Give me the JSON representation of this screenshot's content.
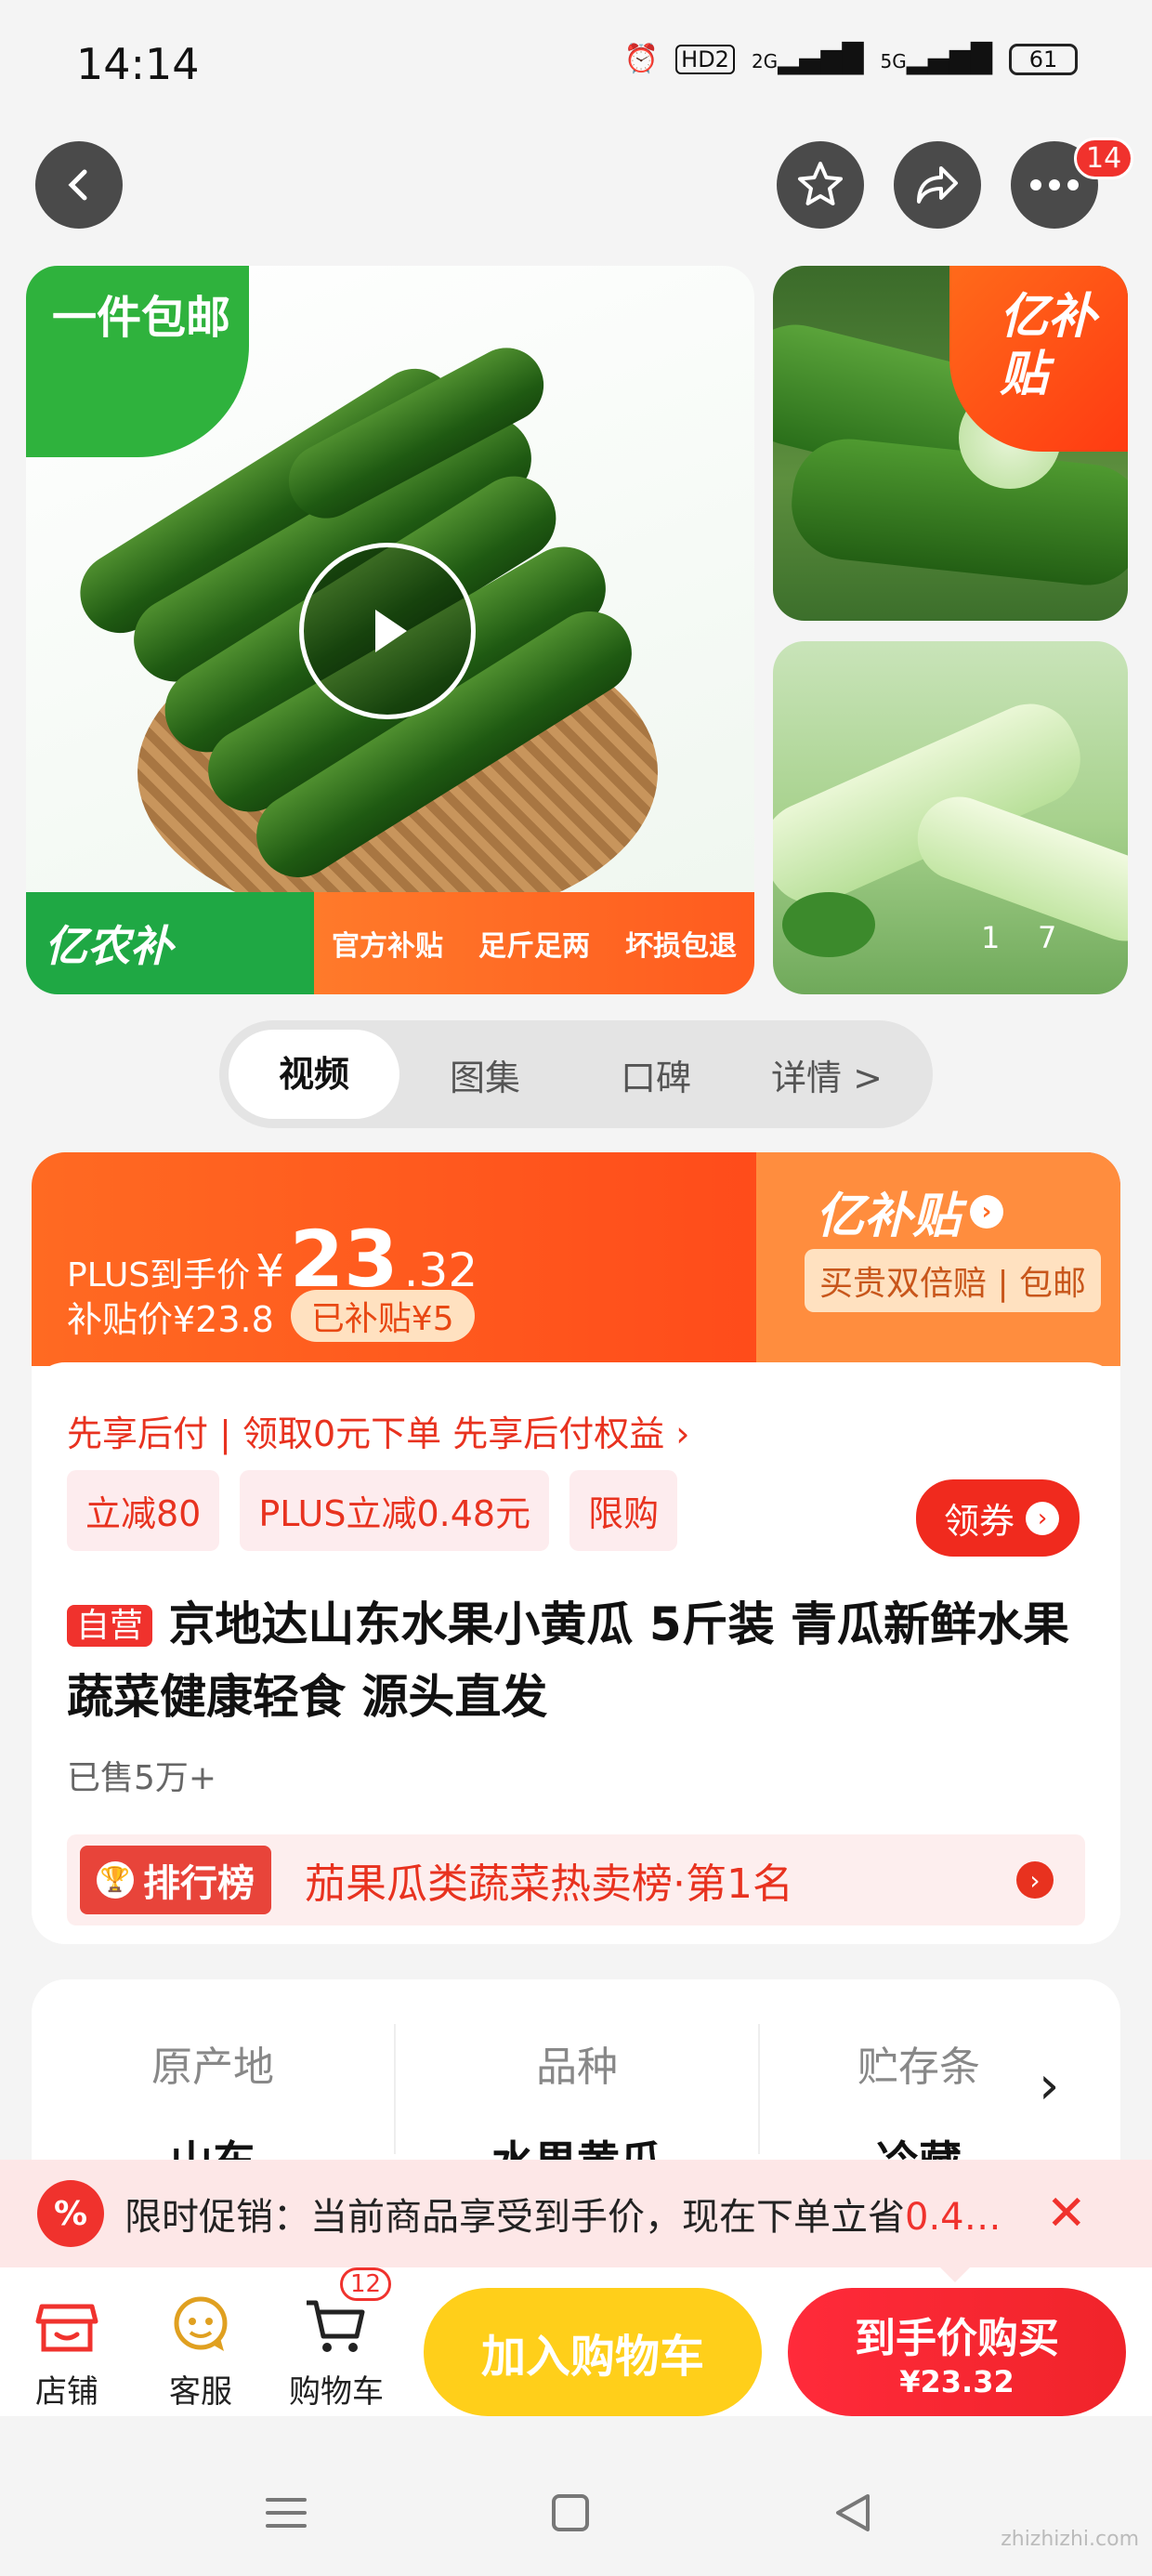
{
  "status": {
    "time": "14:14",
    "hd": "HD2",
    "net1": "2G",
    "net2": "5G",
    "battery": "61"
  },
  "header": {
    "more_badge": "14"
  },
  "gallery": {
    "free_shipping": "一件包邮",
    "brand_badge": "亿农补",
    "service_tags": [
      "官方补贴",
      "足斤足两",
      "坏损包退"
    ],
    "corner_badge": "亿补贴",
    "counter": "1    7"
  },
  "tabs": [
    "视频",
    "图集",
    "口碑",
    "详情 >"
  ],
  "price": {
    "plus_label": "PLUS到手价",
    "currency": "¥",
    "integer": "23",
    "decimal": ".32",
    "subsidy_label": "补贴价¥23.8",
    "subsidized": "已补贴¥5",
    "logo": "亿补贴",
    "badge": "买贵双倍赔 | 包邮"
  },
  "offer": {
    "pay_later": "先享后付 | 领取0元下单 先享后付权益 ›",
    "chips": [
      "立减80",
      "PLUS立减0.48元",
      "限购"
    ],
    "coupon": "领券"
  },
  "product": {
    "self_tag": "自营",
    "title": "京地达山东水果小黄瓜 5斤装 青瓜新鲜水果蔬菜健康轻食 源头直发",
    "sold": "已售5万+"
  },
  "rank": {
    "tag": "排行榜",
    "text": "茄果瓜类蔬菜热卖榜·第1名"
  },
  "attributes": [
    {
      "key": "原产地",
      "value": "山东"
    },
    {
      "key": "品种",
      "value": "水果黄瓜"
    },
    {
      "key": "贮存条",
      "value": "冷藏"
    }
  ],
  "promo": {
    "icon": "%",
    "text": "限时促销：当前商品享受到手价，现在下单立省",
    "highlight": "0.4…"
  },
  "actions": {
    "shop": "店铺",
    "service": "客服",
    "cart": "购物车",
    "cart_count": "12",
    "add_to_cart": "加入购物车",
    "buy_title": "到手价购买",
    "buy_price": "¥23.32"
  },
  "watermark": "zhizhizhi.com",
  "colors": {
    "accent": "#f0322d",
    "orange": "#ff5b1f",
    "yellow": "#ffcf1a",
    "green": "#2fb23d"
  }
}
